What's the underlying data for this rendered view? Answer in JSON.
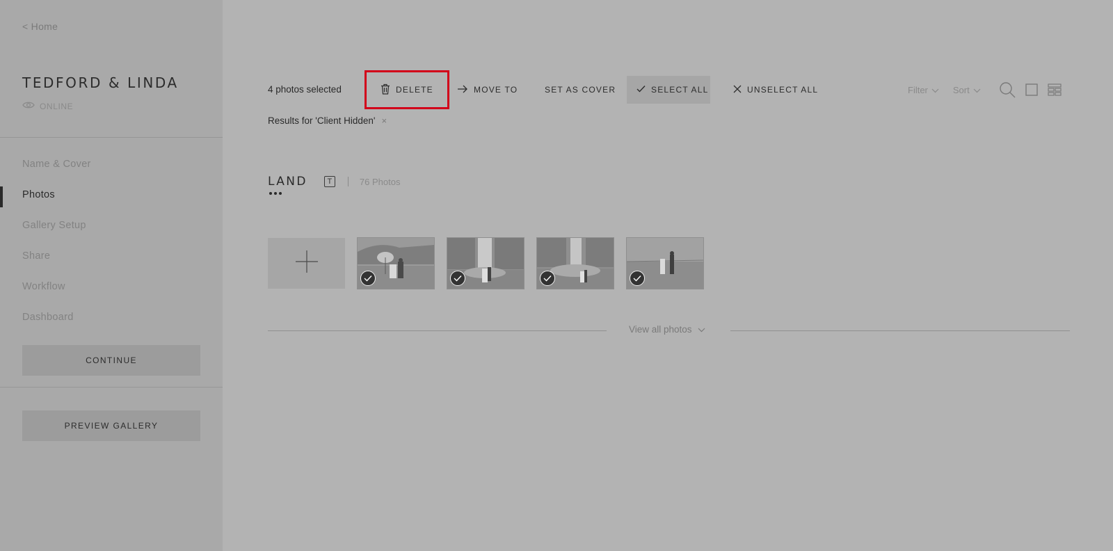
{
  "sidebar": {
    "home_link": "< Home",
    "gallery_title": "TEDFORD & LINDA",
    "status": "ONLINE",
    "nav": [
      {
        "label": "Name & Cover"
      },
      {
        "label": "Photos"
      },
      {
        "label": "Gallery Setup"
      },
      {
        "label": "Share"
      },
      {
        "label": "Workflow"
      },
      {
        "label": "Dashboard"
      }
    ],
    "active_nav": "Photos",
    "continue_label": "CONTINUE",
    "preview_label": "PREVIEW GALLERY"
  },
  "toolbar": {
    "selected_count": "4 photos selected",
    "delete_label": "DELETE",
    "move_label": "MOVE TO",
    "set_cover_label": "SET AS COVER",
    "select_all_label": "SELECT ALL",
    "unselect_all_label": "UNSELECT ALL",
    "filter_label": "Filter",
    "sort_label": "Sort",
    "highlight_color": "#d2001a"
  },
  "results": {
    "text": "Results for 'Client Hidden'",
    "clear": "×"
  },
  "section": {
    "name": "LAND",
    "type_badge": "T",
    "photo_count": "76 Photos"
  },
  "photos": [
    {
      "subject": "couple under umbrella by waterfall",
      "selected": true
    },
    {
      "subject": "couple in front of waterfall",
      "selected": true
    },
    {
      "subject": "couple near misty waterfall",
      "selected": true
    },
    {
      "subject": "couple walking in field",
      "selected": true
    }
  ],
  "view_all_label": "View all photos",
  "icons": {
    "status": "eye-icon",
    "delete": "trash-icon",
    "move": "arrow-right-icon",
    "select_all": "check-icon",
    "unselect_all": "close-icon",
    "search": "search-icon",
    "single_view": "square-icon",
    "grid_view": "grid-icon",
    "add": "plus-icon"
  }
}
